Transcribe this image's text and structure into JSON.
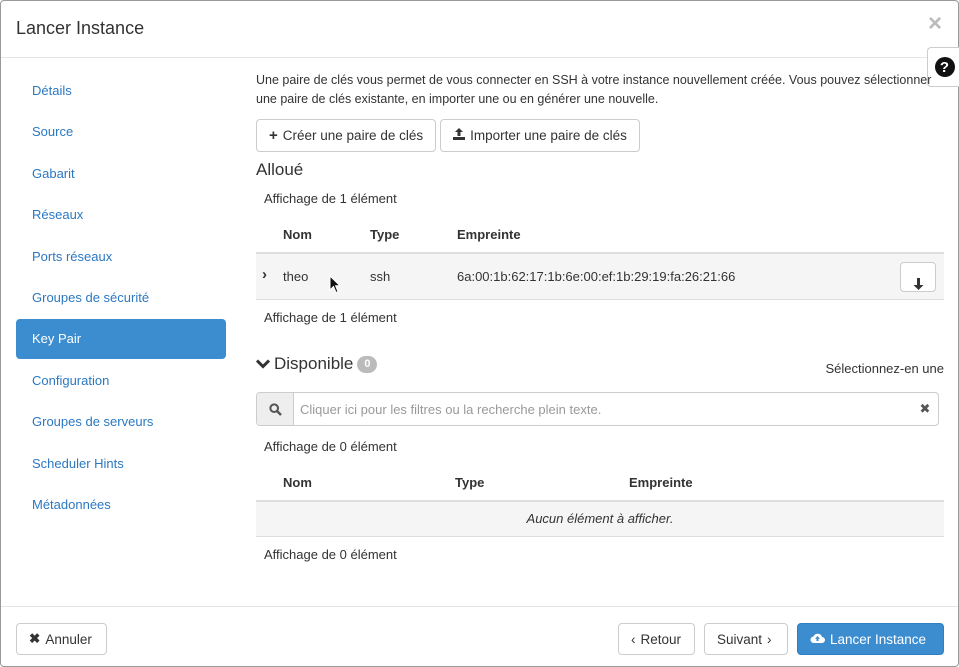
{
  "modal": {
    "title": "Lancer Instance",
    "close_icon": "×",
    "help_icon": "?"
  },
  "sidebar": {
    "items": [
      {
        "label": "Détails"
      },
      {
        "label": "Source"
      },
      {
        "label": "Gabarit"
      },
      {
        "label": "Réseaux"
      },
      {
        "label": "Ports réseaux"
      },
      {
        "label": "Groupes de sécurité"
      },
      {
        "label": "Key Pair"
      },
      {
        "label": "Configuration"
      },
      {
        "label": "Groupes de serveurs"
      },
      {
        "label": "Scheduler Hints"
      },
      {
        "label": "Métadonnées"
      }
    ],
    "active_index": 6
  },
  "main": {
    "intro": "Une paire de clés vous permet de vous connecter en SSH à votre instance nouvellement créée. Vous pouvez sélectionner une paire de clés existante, en importer une ou en générer une nouvelle.",
    "create_button": "Créer une paire de clés",
    "import_button": "Importer une paire de clés",
    "allocated": {
      "title": "Alloué",
      "count_top": "Affichage de 1 élément",
      "count_bottom": "Affichage de 1 élément",
      "columns": [
        "Nom",
        "Type",
        "Empreinte"
      ],
      "rows": [
        {
          "name": "theo",
          "type": "ssh",
          "fingerprint": "6a:00:1b:62:17:1b:6e:00:ef:1b:29:19:fa:26:21:66"
        }
      ]
    },
    "available": {
      "title": "Disponible",
      "badge": "0",
      "select_hint": "Sélectionnez-en une",
      "search_placeholder": "Cliquer ici pour les filtres ou la recherche plein texte.",
      "count_top": "Affichage de 0 élément",
      "count_bottom": "Affichage de 0 élément",
      "columns": [
        "Nom",
        "Type",
        "Empreinte"
      ],
      "empty_text": "Aucun élément à afficher."
    }
  },
  "footer": {
    "cancel": "Annuler",
    "back": "Retour",
    "next": "Suivant",
    "launch": "Lancer Instance"
  },
  "colors": {
    "primary": "#3c8dd0",
    "link": "#2b78c2"
  }
}
